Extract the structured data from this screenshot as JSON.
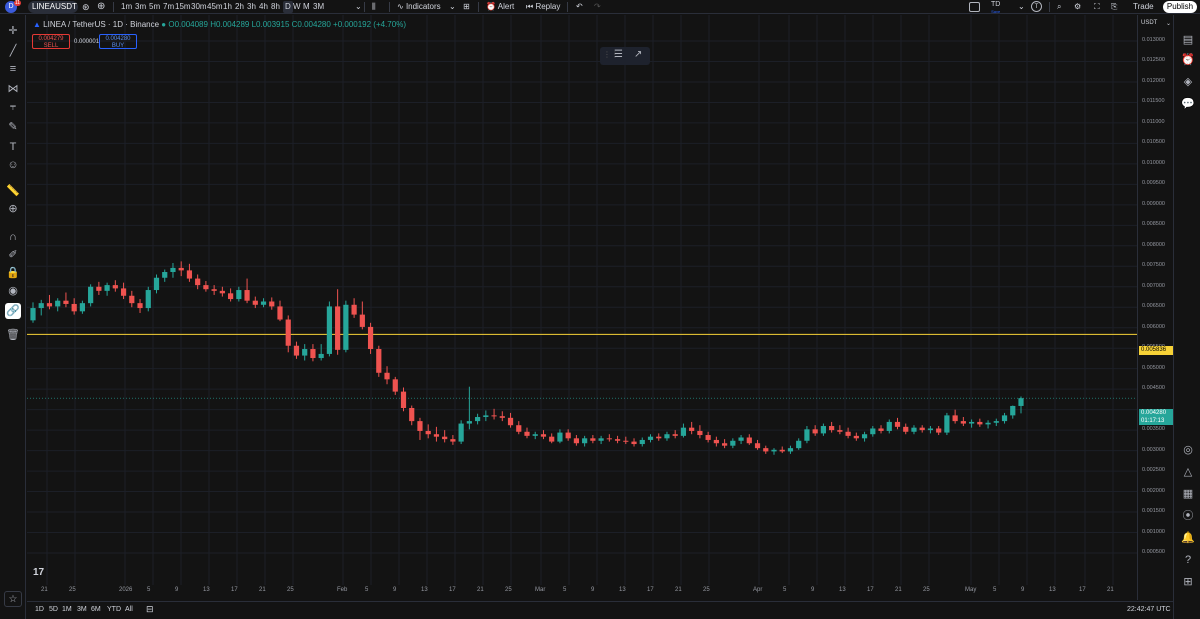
{
  "topbar": {
    "logo_letter": "D",
    "badge": "11",
    "symbol": "LINEAUSDT",
    "intervals": [
      "1m",
      "3m",
      "5m",
      "7m",
      "15m",
      "30m",
      "45m",
      "1h",
      "2h",
      "3h",
      "4h",
      "8h",
      "D",
      "W",
      "M",
      "3M"
    ],
    "active_interval": "D",
    "indicators": "Indicators",
    "alert": "Alert",
    "replay": "Replay",
    "user_initials": "TD",
    "user_sub": "Save",
    "trade": "Trade",
    "publish": "Publish"
  },
  "legend": {
    "title": "LINEA / TetherUS · 1D · Binance",
    "o_label": "O",
    "o": "0.004089",
    "h_label": "H",
    "h": "0.004289",
    "l_label": "L",
    "l": "0.003915",
    "c_label": "C",
    "c": "0.004280",
    "change": "+0.000192 (+4.70%)",
    "sell_price": "0.004279",
    "sell_label": "SELL",
    "spread": "0.000001",
    "buy_price": "0.004280",
    "buy_label": "BUY"
  },
  "price_axis": {
    "currency": "USDT",
    "labels": [
      "0.013000",
      "0.012500",
      "0.012000",
      "0.011500",
      "0.011000",
      "0.010500",
      "0.010000",
      "0.009500",
      "0.009000",
      "0.008500",
      "0.008000",
      "0.007500",
      "0.007000",
      "0.006500",
      "0.006000",
      "0.005500",
      "0.005000",
      "0.004500",
      "0.003500",
      "0.003000",
      "0.002500",
      "0.002000",
      "0.001500",
      "0.001000",
      "0.000500"
    ],
    "hline_price": "0.005836",
    "last_price": "0.004280",
    "countdown": "01:17:13"
  },
  "time_axis": {
    "labels": [
      "21",
      "25",
      "2026",
      "5",
      "9",
      "13",
      "17",
      "21",
      "25",
      "Feb",
      "5",
      "9",
      "13",
      "17",
      "21",
      "25",
      "Mar",
      "5",
      "9",
      "13",
      "17",
      "21",
      "25",
      "Apr",
      "5",
      "9",
      "13",
      "17",
      "21",
      "25",
      "May",
      "5",
      "9",
      "13",
      "17",
      "21"
    ]
  },
  "bottombar": {
    "ranges": [
      "1D",
      "5D",
      "1M",
      "3M",
      "6M",
      "YTD",
      "All"
    ],
    "clock": "22:42:47 UTC"
  },
  "colors": {
    "up": "#26a69a",
    "down": "#ef5350",
    "hline": "#f7d237",
    "bg": "#131313"
  },
  "icons": {
    "left": [
      "crosshair-icon",
      "trendline-icon",
      "fib-icon",
      "pattern-icon",
      "projection-icon",
      "brush-icon",
      "text-icon",
      "emoji-icon",
      "ruler-icon",
      "zoom-icon",
      "magnet-icon",
      "lock-drawings-icon",
      "lock-icon",
      "eye-icon",
      "link-icon",
      "trash-icon",
      "star-icon"
    ],
    "right": [
      "watchlist-icon",
      "alerts-icon",
      "layers-icon",
      "chat-icon",
      "target-icon",
      "ideas-icon",
      "calendar-icon",
      "streams-icon",
      "notifications-icon",
      "help-icon",
      "apps-icon"
    ]
  },
  "chart_data": {
    "type": "candlestick",
    "symbol": "LINEA / TetherUS",
    "interval": "1D",
    "ylim": [
      0.0005,
      0.0133
    ],
    "hline": 0.005836,
    "ohlc": [
      [
        0.00618,
        0.00662,
        0.00612,
        0.00648
      ],
      [
        0.00648,
        0.00668,
        0.0063,
        0.0066
      ],
      [
        0.0066,
        0.0068,
        0.00645,
        0.00652
      ],
      [
        0.00652,
        0.00672,
        0.0064,
        0.00666
      ],
      [
        0.00666,
        0.00686,
        0.0065,
        0.00658
      ],
      [
        0.00658,
        0.00672,
        0.00632,
        0.0064
      ],
      [
        0.0064,
        0.00666,
        0.00634,
        0.0066
      ],
      [
        0.0066,
        0.00706,
        0.00652,
        0.007
      ],
      [
        0.007,
        0.00712,
        0.0068,
        0.0069
      ],
      [
        0.0069,
        0.0071,
        0.00678,
        0.00704
      ],
      [
        0.00704,
        0.00716,
        0.00688,
        0.00696
      ],
      [
        0.00696,
        0.0071,
        0.0067,
        0.00678
      ],
      [
        0.00678,
        0.0069,
        0.0065,
        0.0066
      ],
      [
        0.0066,
        0.0067,
        0.00636,
        0.00648
      ],
      [
        0.00648,
        0.007,
        0.0064,
        0.00692
      ],
      [
        0.00692,
        0.0073,
        0.00684,
        0.00722
      ],
      [
        0.00722,
        0.00742,
        0.00712,
        0.00736
      ],
      [
        0.00736,
        0.00758,
        0.00722,
        0.00746
      ],
      [
        0.00746,
        0.00762,
        0.00726,
        0.0074
      ],
      [
        0.0074,
        0.00756,
        0.00712,
        0.0072
      ],
      [
        0.0072,
        0.0073,
        0.00694,
        0.00704
      ],
      [
        0.00704,
        0.00714,
        0.00688,
        0.00694
      ],
      [
        0.00694,
        0.00704,
        0.0068,
        0.0069
      ],
      [
        0.0069,
        0.007,
        0.00676,
        0.00684
      ],
      [
        0.00684,
        0.00696,
        0.00664,
        0.0067
      ],
      [
        0.0067,
        0.007,
        0.00664,
        0.00692
      ],
      [
        0.00692,
        0.0072,
        0.0066,
        0.00666
      ],
      [
        0.00666,
        0.00676,
        0.00648,
        0.00656
      ],
      [
        0.00656,
        0.00672,
        0.0065,
        0.00664
      ],
      [
        0.00664,
        0.00674,
        0.00644,
        0.00652
      ],
      [
        0.00652,
        0.00666,
        0.00616,
        0.0062
      ],
      [
        0.0062,
        0.0063,
        0.0054,
        0.00556
      ],
      [
        0.00556,
        0.00566,
        0.00524,
        0.00532
      ],
      [
        0.00532,
        0.0056,
        0.0052,
        0.00548
      ],
      [
        0.00548,
        0.0056,
        0.00518,
        0.00526
      ],
      [
        0.00526,
        0.0056,
        0.0052,
        0.00536
      ],
      [
        0.00536,
        0.00664,
        0.0053,
        0.00652
      ],
      [
        0.00652,
        0.00694,
        0.00534,
        0.00546
      ],
      [
        0.00546,
        0.00666,
        0.0054,
        0.00656
      ],
      [
        0.00656,
        0.00672,
        0.00624,
        0.00632
      ],
      [
        0.00632,
        0.00664,
        0.00596,
        0.00602
      ],
      [
        0.00602,
        0.00612,
        0.00536,
        0.00548
      ],
      [
        0.00548,
        0.00556,
        0.0048,
        0.0049
      ],
      [
        0.0049,
        0.00506,
        0.00462,
        0.00474
      ],
      [
        0.00474,
        0.0048,
        0.00436,
        0.00444
      ],
      [
        0.00444,
        0.00454,
        0.00396,
        0.00404
      ],
      [
        0.00404,
        0.0041,
        0.00362,
        0.00372
      ],
      [
        0.00372,
        0.0038,
        0.00326,
        0.00348
      ],
      [
        0.00348,
        0.00364,
        0.0033,
        0.0034
      ],
      [
        0.0034,
        0.00358,
        0.00322,
        0.00334
      ],
      [
        0.00334,
        0.0035,
        0.0032,
        0.00328
      ],
      [
        0.00328,
        0.00338,
        0.00314,
        0.00322
      ],
      [
        0.00322,
        0.00374,
        0.00316,
        0.00366
      ],
      [
        0.00366,
        0.00456,
        0.00352,
        0.00372
      ],
      [
        0.00372,
        0.0039,
        0.00364,
        0.00382
      ],
      [
        0.00382,
        0.00398,
        0.00372,
        0.00386
      ],
      [
        0.00386,
        0.00402,
        0.00376,
        0.00384
      ],
      [
        0.00384,
        0.00396,
        0.00372,
        0.0038
      ],
      [
        0.0038,
        0.00392,
        0.00356,
        0.00362
      ],
      [
        0.00362,
        0.00372,
        0.0034,
        0.00346
      ],
      [
        0.00346,
        0.00356,
        0.0033,
        0.00336
      ],
      [
        0.00336,
        0.00346,
        0.00328,
        0.0034
      ],
      [
        0.0034,
        0.0035,
        0.00328,
        0.00334
      ],
      [
        0.00334,
        0.00342,
        0.00318,
        0.00322
      ],
      [
        0.00322,
        0.00352,
        0.00318,
        0.00344
      ],
      [
        0.00344,
        0.00352,
        0.00324,
        0.0033
      ],
      [
        0.0033,
        0.00338,
        0.00312,
        0.00318
      ],
      [
        0.00318,
        0.00336,
        0.0031,
        0.0033
      ],
      [
        0.0033,
        0.00338,
        0.00318,
        0.00324
      ],
      [
        0.00324,
        0.00336,
        0.00316,
        0.0033
      ],
      [
        0.0033,
        0.0034,
        0.00322,
        0.00328
      ],
      [
        0.00328,
        0.00336,
        0.00318,
        0.00324
      ],
      [
        0.00324,
        0.00334,
        0.00316,
        0.00322
      ],
      [
        0.00322,
        0.0033,
        0.0031,
        0.00316
      ],
      [
        0.00316,
        0.00332,
        0.0031,
        0.00326
      ],
      [
        0.00326,
        0.0034,
        0.0032,
        0.00334
      ],
      [
        0.00334,
        0.00342,
        0.00324,
        0.0033
      ],
      [
        0.0033,
        0.00346,
        0.00324,
        0.0034
      ],
      [
        0.0034,
        0.0035,
        0.0033,
        0.00336
      ],
      [
        0.00336,
        0.00366,
        0.00332,
        0.00356
      ],
      [
        0.00356,
        0.0037,
        0.0034,
        0.00348
      ],
      [
        0.00348,
        0.00362,
        0.0033,
        0.00338
      ],
      [
        0.00338,
        0.00346,
        0.0032,
        0.00326
      ],
      [
        0.00326,
        0.00334,
        0.0031,
        0.00318
      ],
      [
        0.00318,
        0.00328,
        0.00306,
        0.00312
      ],
      [
        0.00312,
        0.0033,
        0.00306,
        0.00324
      ],
      [
        0.00324,
        0.00338,
        0.00316,
        0.00332
      ],
      [
        0.00332,
        0.0034,
        0.00314,
        0.00318
      ],
      [
        0.00318,
        0.00326,
        0.00302,
        0.00306
      ],
      [
        0.00306,
        0.00312,
        0.00292,
        0.00298
      ],
      [
        0.00298,
        0.00306,
        0.0029,
        0.00302
      ],
      [
        0.00302,
        0.0031,
        0.00294,
        0.00298
      ],
      [
        0.00298,
        0.00312,
        0.00292,
        0.00306
      ],
      [
        0.00306,
        0.0033,
        0.00302,
        0.00324
      ],
      [
        0.00324,
        0.0036,
        0.00318,
        0.00352
      ],
      [
        0.00352,
        0.00362,
        0.00336,
        0.00342
      ],
      [
        0.00342,
        0.00366,
        0.00336,
        0.0036
      ],
      [
        0.0036,
        0.0037,
        0.00344,
        0.0035
      ],
      [
        0.0035,
        0.00362,
        0.0034,
        0.00346
      ],
      [
        0.00346,
        0.00356,
        0.0033,
        0.00336
      ],
      [
        0.00336,
        0.00344,
        0.00324,
        0.0033
      ],
      [
        0.0033,
        0.00346,
        0.00322,
        0.0034
      ],
      [
        0.0034,
        0.0036,
        0.00334,
        0.00354
      ],
      [
        0.00354,
        0.00362,
        0.00342,
        0.00348
      ],
      [
        0.00348,
        0.00376,
        0.00342,
        0.0037
      ],
      [
        0.0037,
        0.0038,
        0.00352,
        0.00358
      ],
      [
        0.00358,
        0.00366,
        0.0034,
        0.00346
      ],
      [
        0.00346,
        0.00362,
        0.0034,
        0.00356
      ],
      [
        0.00356,
        0.00362,
        0.00344,
        0.0035
      ],
      [
        0.0035,
        0.0036,
        0.00342,
        0.00354
      ],
      [
        0.00354,
        0.0036,
        0.00338,
        0.00344
      ],
      [
        0.00344,
        0.00392,
        0.00338,
        0.00386
      ],
      [
        0.00386,
        0.004,
        0.00366,
        0.00372
      ],
      [
        0.00372,
        0.00382,
        0.0036,
        0.00366
      ],
      [
        0.00366,
        0.00376,
        0.00356,
        0.0037
      ],
      [
        0.0037,
        0.00378,
        0.00358,
        0.00364
      ],
      [
        0.00364,
        0.00374,
        0.00354,
        0.00368
      ],
      [
        0.00368,
        0.00378,
        0.0036,
        0.00372
      ],
      [
        0.00372,
        0.00392,
        0.00366,
        0.00386
      ],
      [
        0.00386,
        0.0041,
        0.00378,
        0.00409
      ],
      [
        0.00409,
        0.00432,
        0.00391,
        0.00428
      ]
    ]
  }
}
